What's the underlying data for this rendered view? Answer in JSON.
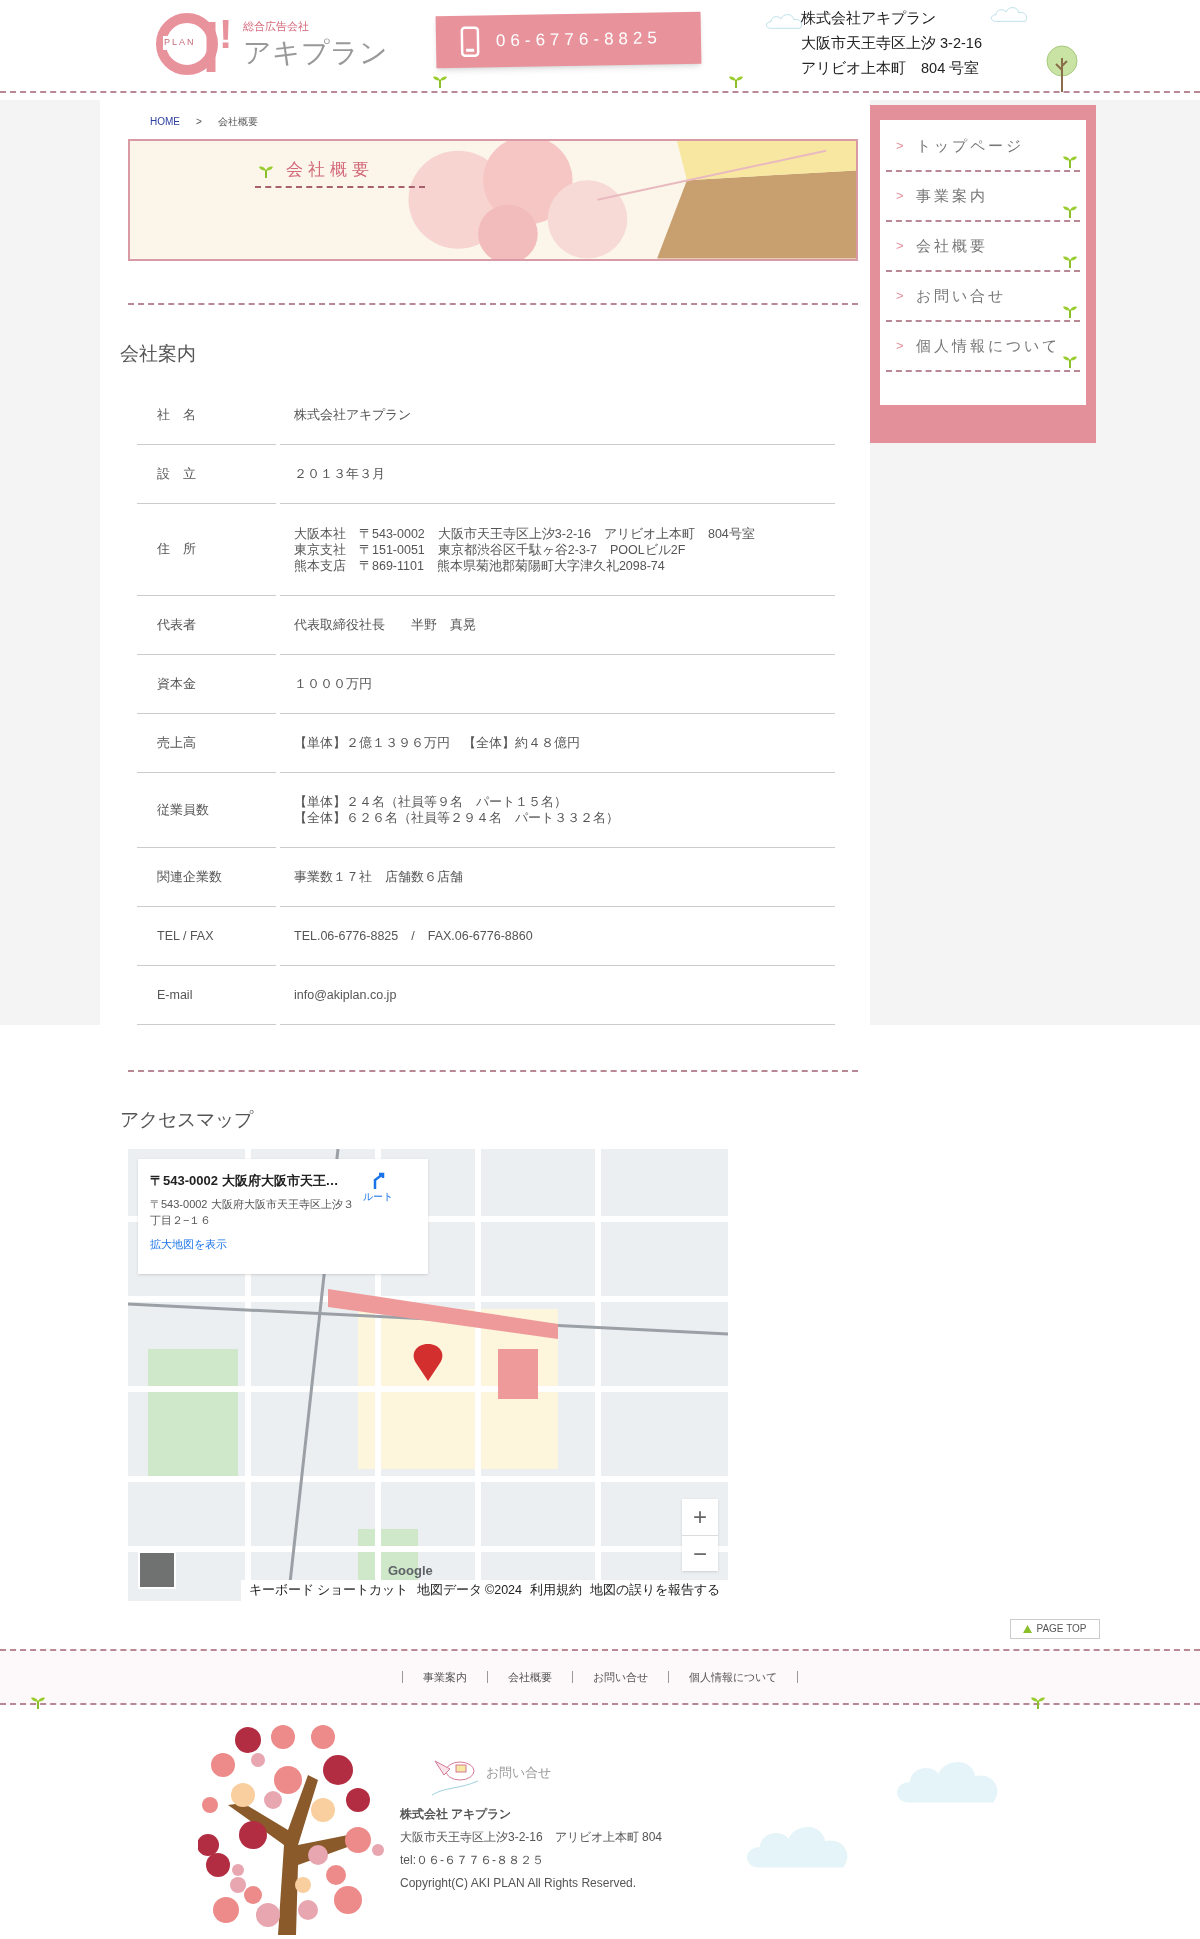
{
  "header": {
    "logo_mark": "PLAN",
    "logo_exclaim": "!",
    "logo_tagline": "総合広告会社",
    "logo_name": "アキプラン",
    "phone": "06-6776-8825",
    "address_lines": [
      "株式会社アキプラン",
      "大阪市天王寺区上汐 3-2-16",
      "アリビオ上本町　804 号室"
    ]
  },
  "breadcrumb": {
    "items": [
      "HOME",
      "会社概要"
    ],
    "separator": ">"
  },
  "banner": {
    "title": "会社概要"
  },
  "sidebar": {
    "items": [
      {
        "marker": ">",
        "label": "トップページ"
      },
      {
        "marker": ">",
        "label": "事業案内"
      },
      {
        "marker": ">",
        "label": "会社概要"
      },
      {
        "marker": ">",
        "label": "お問い合せ"
      },
      {
        "marker": ">",
        "label": "個人情報について"
      }
    ]
  },
  "company": {
    "heading": "会社案内",
    "rows": [
      {
        "label": "社　名",
        "lines": [
          "株式会社アキプラン"
        ]
      },
      {
        "label": "設　立",
        "lines": [
          "２０１３年３月"
        ]
      },
      {
        "label": "住　所",
        "lines": [
          "大阪本社　〒543-0002　大阪市天王寺区上汐3-2-16　アリビオ上本町　804号室",
          "東京支社　〒151-0051　東京都渋谷区千駄ヶ谷2-3-7　POOLビル2F",
          "熊本支店　〒869-1101　熊本県菊池郡菊陽町大字津久礼2098-74"
        ]
      },
      {
        "label": "代表者",
        "lines": [
          "代表取締役社長　　半野　真晃"
        ]
      },
      {
        "label": "資本金",
        "lines": [
          "１０００万円"
        ]
      },
      {
        "label": "売上高",
        "lines": [
          "【単体】２億１３９６万円　【全体】約４８億円"
        ]
      },
      {
        "label": "従業員数",
        "lines": [
          "【単体】２４名（社員等９名　パート１５名）",
          "【全体】６２６名（社員等２９４名　パート３３２名）"
        ]
      },
      {
        "label": "関連企業数",
        "lines": [
          "事業数１７社　店舗数６店舗"
        ]
      },
      {
        "label": "TEL / FAX",
        "lines": [
          "TEL.06-6776-8825　/　FAX.06-6776-8860"
        ]
      },
      {
        "label": "E-mail",
        "lines": [
          "info@akiplan.co.jp"
        ]
      }
    ]
  },
  "access": {
    "heading": "アクセスマップ",
    "map": {
      "card": {
        "title": "〒543-0002 大阪府大阪市天王…",
        "address": "〒543-0002 大阪府大阪市天王寺区上汐３丁目２−１６",
        "route": "ルート",
        "larger_map": "拡大地図を表示"
      },
      "zoom_in": "+",
      "zoom_out": "−",
      "google": "Google",
      "attribution": [
        "キーボード ショートカット",
        "地図データ ©2024",
        "利用規約",
        "地図の誤りを報告する"
      ]
    }
  },
  "page_top": "PAGE TOP",
  "footer_nav": [
    "事業案内",
    "会社概要",
    "お問い合せ",
    "個人情報について"
  ],
  "footer": {
    "contact": "お問い合せ",
    "company": "株式会社 アキプラン",
    "address": "大阪市天王寺区上汐3-2-16　アリビオ上本町 804",
    "tel": "tel:０６-６７７６-８８２５",
    "copyright": "Copyright(C) AKI PLAN All Rights Reserved."
  }
}
